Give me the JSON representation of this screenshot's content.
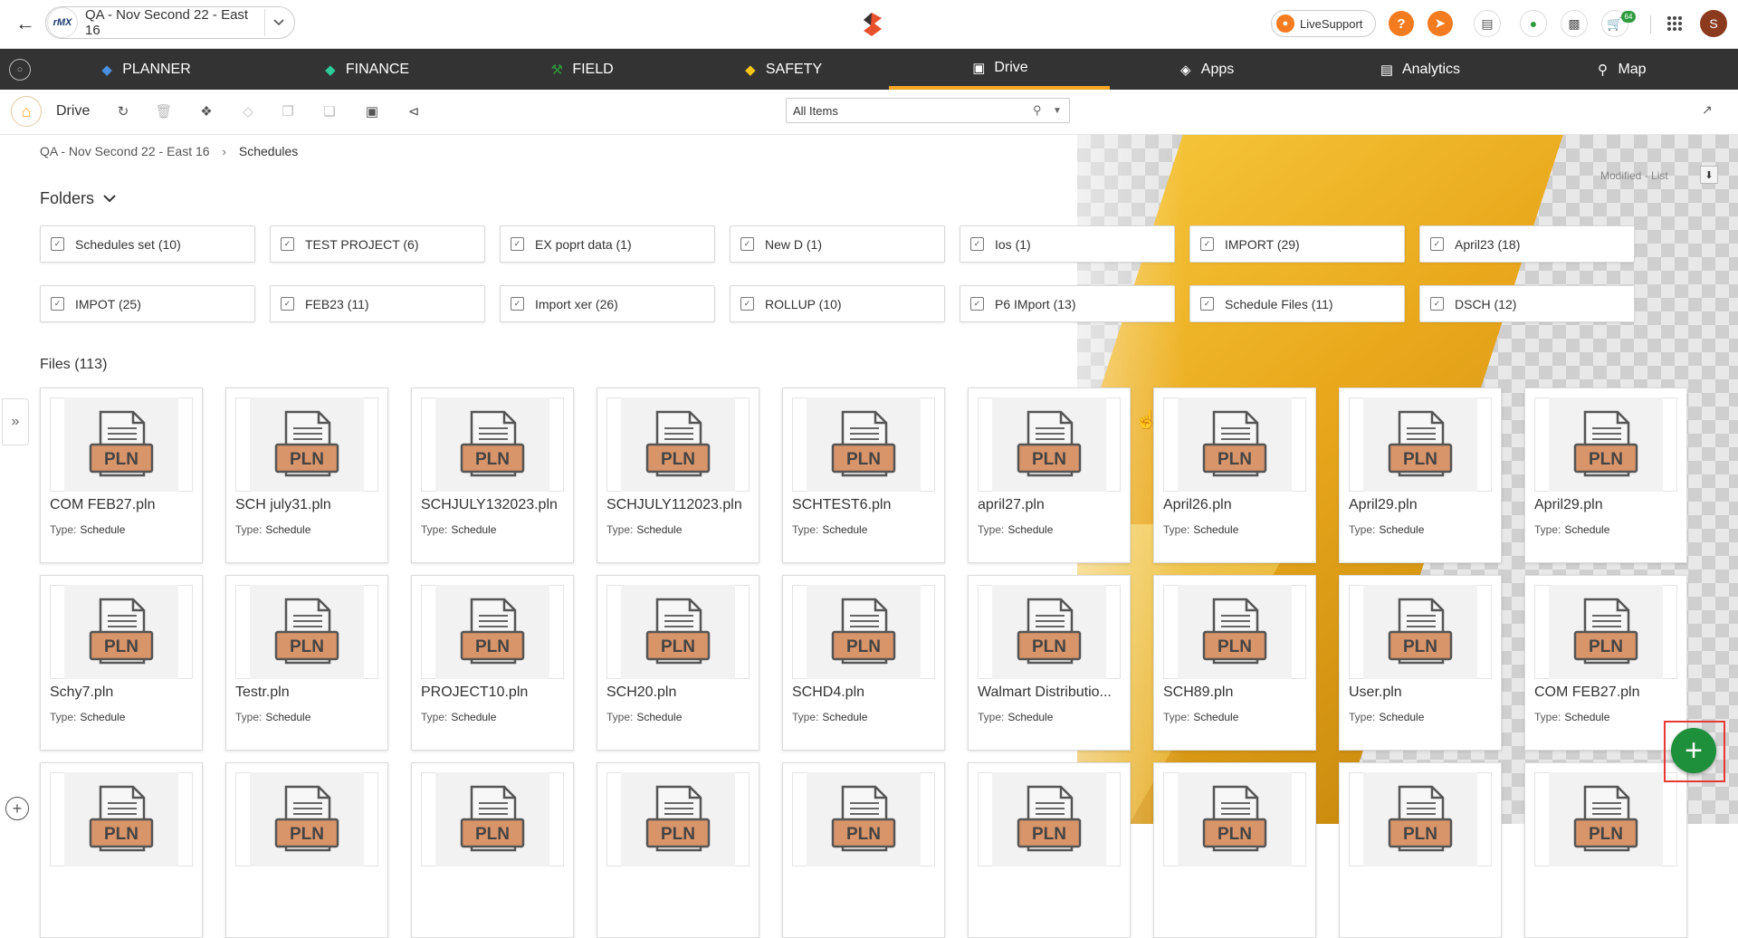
{
  "header": {
    "project_title": "QA - Nov Second 22 - East 16",
    "project_logo_text": "rMX",
    "livesupport_label": "LiveSupport",
    "help_label": "?",
    "cart_badge": "64",
    "avatar_initial": "S"
  },
  "nav": {
    "items": [
      {
        "label": "PLANNER",
        "icon": "planner-icon",
        "color": "#4a90e2"
      },
      {
        "label": "FINANCE",
        "icon": "finance-icon",
        "color": "#2ecc9a"
      },
      {
        "label": "FIELD",
        "icon": "field-icon",
        "color": "#2e9c3e"
      },
      {
        "label": "SAFETY",
        "icon": "safety-icon",
        "color": "#f5c518"
      },
      {
        "label": "Drive",
        "icon": "drive-icon",
        "active": true
      },
      {
        "label": "Apps",
        "icon": "apps-icon"
      },
      {
        "label": "Analytics",
        "icon": "analytics-icon"
      },
      {
        "label": "Map",
        "icon": "map-icon"
      }
    ]
  },
  "toolbar": {
    "title": "Drive",
    "search_value": "All Items"
  },
  "breadcrumb": {
    "root": "QA - Nov Second 22 - East 16",
    "current": "Schedules"
  },
  "sort_label": "Modified - List",
  "folders_header": "Folders",
  "folders": [
    "Schedules set (10)",
    "TEST PROJECT (6)",
    "EX poprt data (1)",
    "New D (1)",
    "Ios (1)",
    "IMPORT (29)",
    "April23 (18)",
    "IMPOT (25)",
    "FEB23 (11)",
    "Import xer (26)",
    "ROLLUP (10)",
    "P6 IMport (13)",
    "Schedule Files (11)",
    "DSCH (12)"
  ],
  "files_header": "Files (113)",
  "type_label": "Type:",
  "file_icon_text": "PLN",
  "files": [
    {
      "name": "COM FEB27.pln",
      "type": "Schedule"
    },
    {
      "name": "SCH july31.pln",
      "type": "Schedule"
    },
    {
      "name": "SCHJULY132023.pln",
      "type": "Schedule"
    },
    {
      "name": "SCHJULY112023.pln",
      "type": "Schedule"
    },
    {
      "name": "SCHTEST6.pln",
      "type": "Schedule"
    },
    {
      "name": "april27.pln",
      "type": "Schedule"
    },
    {
      "name": "April26.pln",
      "type": "Schedule"
    },
    {
      "name": "April29.pln",
      "type": "Schedule"
    },
    {
      "name": "April29.pln",
      "type": "Schedule"
    },
    {
      "name": "Schy7.pln",
      "type": "Schedule"
    },
    {
      "name": "Testr.pln",
      "type": "Schedule"
    },
    {
      "name": "PROJECT10.pln",
      "type": "Schedule"
    },
    {
      "name": "SCH20.pln",
      "type": "Schedule"
    },
    {
      "name": "SCHD4.pln",
      "type": "Schedule"
    },
    {
      "name": "Walmart Distributio...",
      "type": "Schedule"
    },
    {
      "name": "SCH89.pln",
      "type": "Schedule"
    },
    {
      "name": "User.pln",
      "type": "Schedule"
    },
    {
      "name": "COM FEB27.pln",
      "type": "Schedule"
    },
    {
      "name": "",
      "type": ""
    },
    {
      "name": "",
      "type": ""
    },
    {
      "name": "",
      "type": ""
    },
    {
      "name": "",
      "type": ""
    },
    {
      "name": "",
      "type": ""
    },
    {
      "name": "",
      "type": ""
    },
    {
      "name": "",
      "type": ""
    },
    {
      "name": "",
      "type": ""
    },
    {
      "name": "",
      "type": ""
    }
  ],
  "colors": {
    "accent": "#f5a623",
    "nav_bg": "#333333",
    "fab": "#1e8f3a",
    "file_icon": "#d9956a"
  }
}
